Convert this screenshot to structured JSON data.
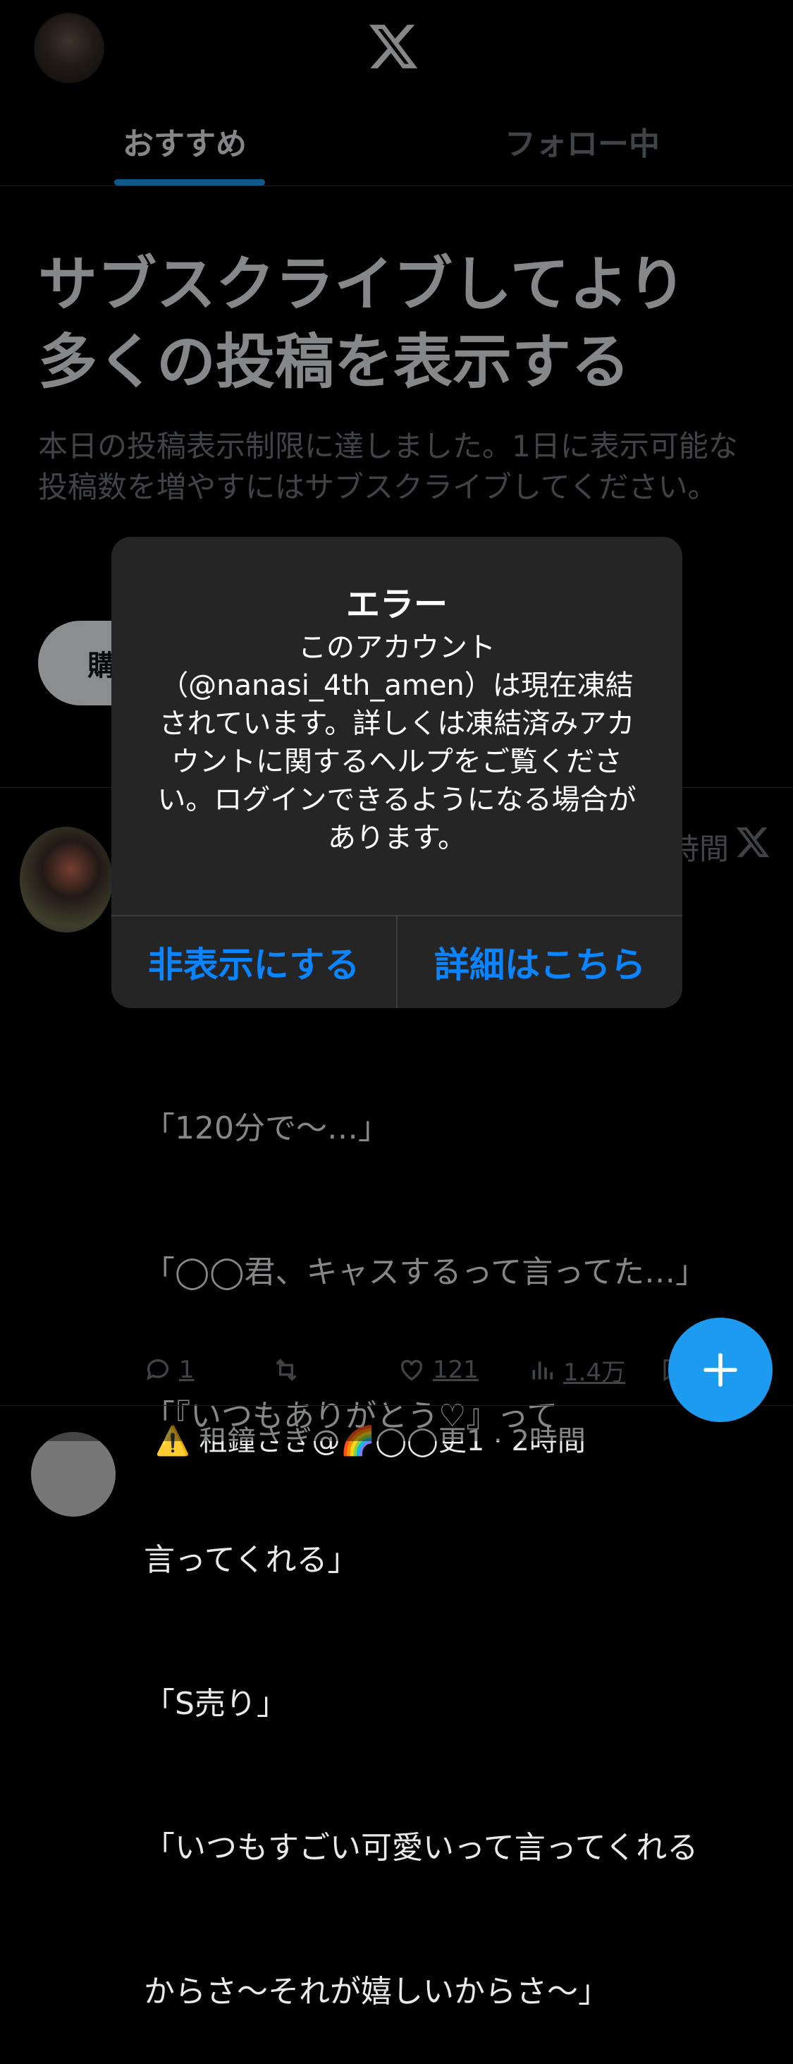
{
  "header": {
    "tabs": [
      {
        "label": "おすすめ",
        "active": true
      },
      {
        "label": "フォロー中",
        "active": false
      }
    ]
  },
  "promo": {
    "title": "サブスクライブしてより多くの投稿を表示する",
    "body": "本日の投稿表示制限に達しました。1日に表示可能な投稿数を増やすにはサブスクライブしてください。",
    "button_label": "購"
  },
  "post": {
    "time": "時間",
    "text_lines": [
      "「120分で〜…」",
      "「◯◯君、キャスするって言ってた…」",
      "「『いつもありがとう♡』って",
      "言ってくれる」",
      "「S売り」",
      "「いつもすごい可愛いって言ってくれる",
      "からさ〜それが嬉しいからさ〜」"
    ],
    "replies": "1",
    "likes": "121",
    "views": "1.4万"
  },
  "next_post": {
    "preview": "⚠️ 租鐘さぎ@🌈◯◯更1 · 2時間"
  },
  "alert": {
    "title": "エラー",
    "message": "このアカウント（@nanasi_4th_amen）は現在凍結されています。詳しくは凍結済みアカウントに関するヘルプをご覧ください。ログインできるようになる場合があります。",
    "dismiss_label": "非表示にする",
    "details_label": "詳細はこちら"
  },
  "colors": {
    "accent": "#1d9bf0",
    "alert_button": "#0a84ff",
    "alert_bg": "#252525"
  }
}
